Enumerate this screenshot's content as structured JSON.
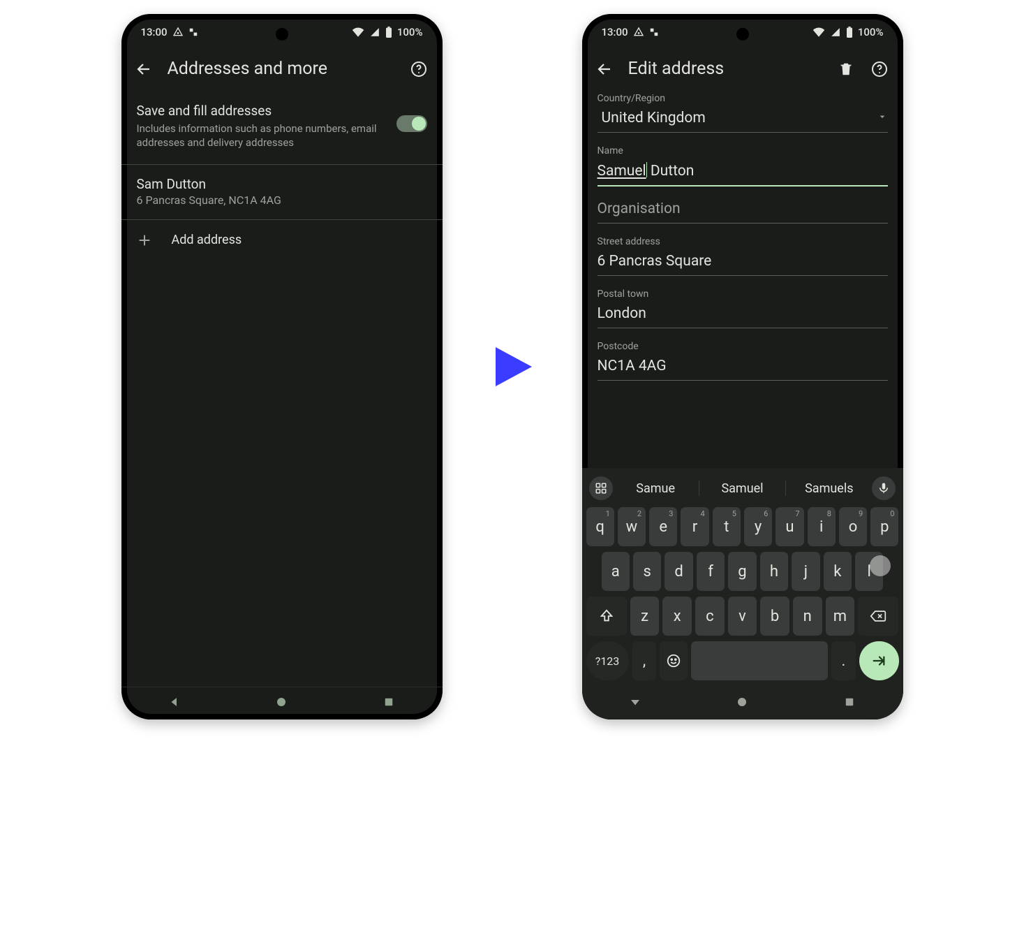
{
  "status": {
    "time": "13:00",
    "battery": "100%"
  },
  "left_screen": {
    "title": "Addresses and more",
    "toggle": {
      "title": "Save and fill addresses",
      "subtitle": "Includes information such as phone numbers, email addresses and delivery addresses"
    },
    "address": {
      "name": "Sam Dutton",
      "line": "6 Pancras Square, NC1A 4AG"
    },
    "add_label": "Add address"
  },
  "right_screen": {
    "title": "Edit address",
    "fields": {
      "country_label": "Country/Region",
      "country_value": "United Kingdom",
      "name_label": "Name",
      "name_first": "Samuel",
      "name_last": "Dutton",
      "org_label": "Organisation",
      "street_label": "Street address",
      "street_value": "6 Pancras Square",
      "town_label": "Postal town",
      "town_value": "London",
      "postcode_label": "Postcode",
      "postcode_value": "NC1A 4AG"
    }
  },
  "keyboard": {
    "suggestions": [
      "Samue",
      "Samuel",
      "Samuels"
    ],
    "row1": [
      "q",
      "w",
      "e",
      "r",
      "t",
      "y",
      "u",
      "i",
      "o",
      "p"
    ],
    "row1_sup": [
      "1",
      "2",
      "3",
      "4",
      "5",
      "6",
      "7",
      "8",
      "9",
      "0"
    ],
    "row2": [
      "a",
      "s",
      "d",
      "f",
      "g",
      "h",
      "j",
      "k",
      "l"
    ],
    "row3": [
      "z",
      "x",
      "c",
      "v",
      "b",
      "n",
      "m"
    ],
    "sym": "?123",
    "comma": ",",
    "period": "."
  }
}
